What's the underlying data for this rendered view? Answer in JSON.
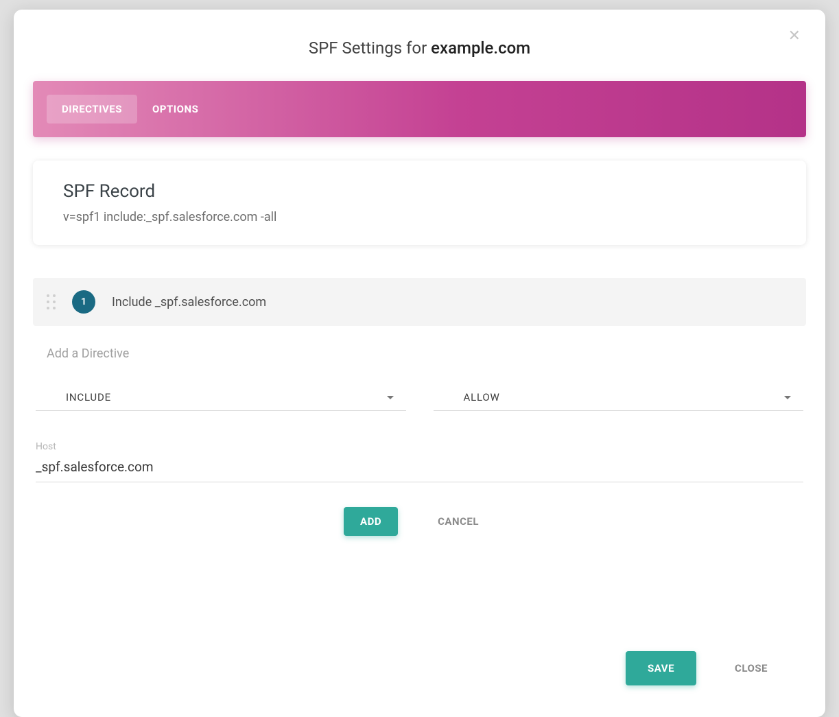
{
  "header": {
    "title_prefix": "SPF Settings for ",
    "domain": "example.com"
  },
  "tabs": [
    {
      "label": "DIRECTIVES",
      "active": true
    },
    {
      "label": "OPTIONS",
      "active": false
    }
  ],
  "record": {
    "title": "SPF Record",
    "value": "v=spf1 include:_spf.salesforce.com -all"
  },
  "directives": [
    {
      "badge": "1",
      "text": "Include _spf.salesforce.com"
    }
  ],
  "addDirective": {
    "label": "Add a Directive",
    "mechanismSelect": "INCLUDE",
    "qualifierSelect": "ALLOW",
    "hostLabel": "Host",
    "hostValue": "_spf.salesforce.com",
    "addBtn": "ADD",
    "cancelBtn": "CANCEL"
  },
  "footer": {
    "save": "SAVE",
    "close": "CLOSE"
  }
}
